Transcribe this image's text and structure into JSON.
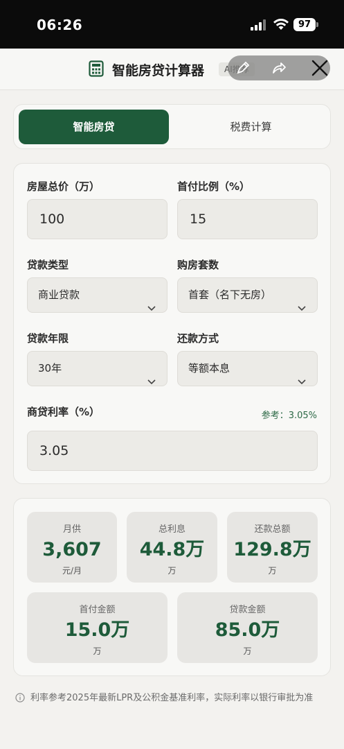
{
  "status_bar": {
    "time": "06:26",
    "battery": "97"
  },
  "header": {
    "title": "智能房贷计算器",
    "badge": "AI推荐"
  },
  "tabs": [
    {
      "label": "智能房贷",
      "active": true
    },
    {
      "label": "税费计算",
      "active": false
    }
  ],
  "form": {
    "total_price": {
      "label": "房屋总价（万）",
      "value": "100"
    },
    "down_ratio": {
      "label": "首付比例（%）",
      "value": "15"
    },
    "loan_type": {
      "label": "贷款类型",
      "value": "商业贷款"
    },
    "house_count": {
      "label": "购房套数",
      "value": "首套（名下无房）"
    },
    "loan_years": {
      "label": "贷款年限",
      "value": "30年"
    },
    "repay_method": {
      "label": "还款方式",
      "value": "等额本息"
    },
    "rate": {
      "label": "商贷利率（%）",
      "reference": "参考：3.05%",
      "value": "3.05"
    }
  },
  "results": [
    {
      "label": "月供",
      "value": "3,607",
      "unit": "元/月"
    },
    {
      "label": "总利息",
      "value": "44.8万",
      "unit": "万"
    },
    {
      "label": "还款总额",
      "value": "129.8万",
      "unit": "万"
    },
    {
      "label": "首付金额",
      "value": "15.0万",
      "unit": "万"
    },
    {
      "label": "贷款金额",
      "value": "85.0万",
      "unit": "万"
    }
  ],
  "footnote": "利率参考2025年最新LPR及公积金基准利率，实际利率以银行审批为准",
  "colors": {
    "accent": "#1e5b3a",
    "background": "#f3f2ef"
  }
}
